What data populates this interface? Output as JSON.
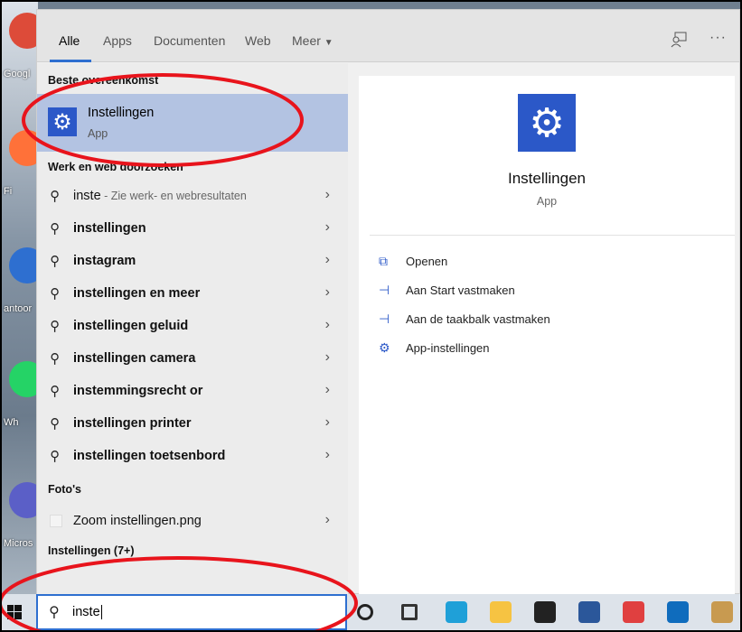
{
  "desktop": {
    "icons": [
      {
        "label": "Googl",
        "color": "#dd4b39"
      },
      {
        "label": "Fi",
        "color": "#ff7139"
      },
      {
        "label": "antoor",
        "color": "#2e6fd0"
      },
      {
        "label": "Wh",
        "color": "#25d366"
      },
      {
        "label": "Micros",
        "color": "#5b5fc7"
      }
    ]
  },
  "tabs": [
    {
      "label": "Alle",
      "active": true
    },
    {
      "label": "Apps"
    },
    {
      "label": "Documenten"
    },
    {
      "label": "Web"
    },
    {
      "label": "Meer"
    }
  ],
  "header_icons": [
    "feedback-icon",
    "more-icon"
  ],
  "more_glyph": "···",
  "best_match": {
    "section": "Beste overeenkomst",
    "title": "Instellingen",
    "type": "App"
  },
  "web": {
    "section": "Werk en web doorzoeken",
    "items": [
      {
        "text": "inste",
        "sub": " - Zie werk- en webresultaten"
      },
      {
        "text": "instellingen"
      },
      {
        "text": "instagram"
      },
      {
        "text": "instellingen en meer"
      },
      {
        "text": "instellingen geluid"
      },
      {
        "text": "instellingen camera"
      },
      {
        "text": "instemmingsrecht or"
      },
      {
        "text": "instellingen printer"
      },
      {
        "text": "instellingen toetsenbord"
      }
    ]
  },
  "photos": {
    "section": "Foto's",
    "items": [
      {
        "text": "Zoom instellingen.png"
      }
    ]
  },
  "settings_section": "Instellingen (7+)",
  "detail": {
    "title": "Instellingen",
    "type": "App",
    "actions": [
      {
        "label": "Openen",
        "icon": "open-icon",
        "glyph": "⧉"
      },
      {
        "label": "Aan Start vastmaken",
        "icon": "pin-icon",
        "glyph": "⊣"
      },
      {
        "label": "Aan de taakbalk vastmaken",
        "icon": "pin-icon",
        "glyph": "⊣"
      },
      {
        "label": "App-instellingen",
        "icon": "gear-icon",
        "glyph": "⚙"
      }
    ]
  },
  "search": {
    "value": "inste"
  },
  "taskbar": {
    "apps": [
      {
        "name": "cortana",
        "color": "#222"
      },
      {
        "name": "task-view",
        "color": "#333"
      },
      {
        "name": "edge",
        "color": "#1fa0d8"
      },
      {
        "name": "file-explorer",
        "color": "#f6c342"
      },
      {
        "name": "obs",
        "color": "#222"
      },
      {
        "name": "word",
        "color": "#2b579a"
      },
      {
        "name": "snipping-tool",
        "color": "#e04040"
      },
      {
        "name": "outlook",
        "color": "#0f6cbd"
      },
      {
        "name": "paint",
        "color": "#c89a50"
      }
    ]
  },
  "colors": {
    "accent": "#2e6fd0",
    "highlight": "#b3c3e2",
    "annotation": "#e8141c"
  }
}
